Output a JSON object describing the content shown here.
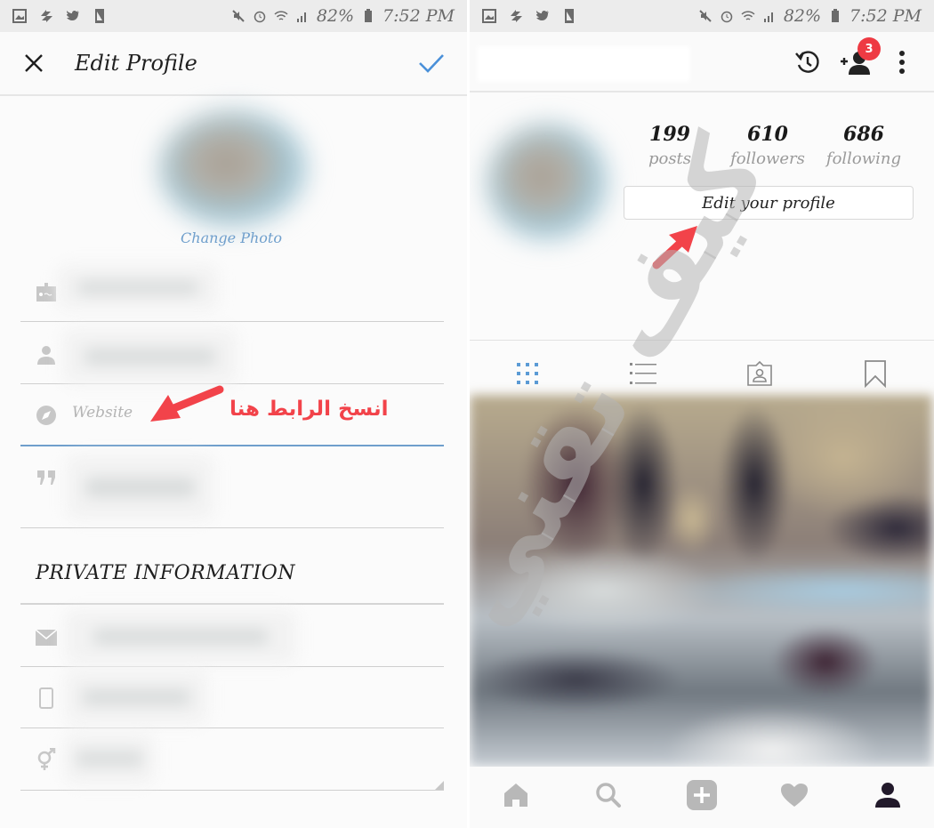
{
  "status_bar": {
    "battery": "82%",
    "time": "7:52 PM",
    "left_icons": [
      "gallery-icon",
      "pinwheel-icon",
      "twitter-icon",
      "tablet-icon"
    ],
    "right_icons": [
      "mute-icon",
      "alarm-icon",
      "wifi-icon",
      "signal-icon",
      "battery-icon"
    ]
  },
  "edit_profile": {
    "title": "Edit Profile",
    "close_icon": "close-icon",
    "save_icon": "check-icon",
    "change_photo": "Change Photo",
    "fields": [
      {
        "icon": "id-card-icon",
        "value": "",
        "blurred": true
      },
      {
        "icon": "person-icon",
        "value": "",
        "blurred": true
      },
      {
        "icon": "compass-icon",
        "value": "",
        "placeholder": "Website",
        "blurred": false
      },
      {
        "icon": "quote-icon",
        "value": "",
        "blurred": true
      }
    ],
    "private_section_title": "PRIVATE INFORMATION",
    "private_fields": [
      {
        "icon": "email-icon",
        "value": "",
        "blurred": true
      },
      {
        "icon": "phone-icon",
        "value": "",
        "blurred": true
      },
      {
        "icon": "gender-icon",
        "value": "",
        "blurred": true
      }
    ],
    "annotation": "انسخ الرابط هنا",
    "accent_color": "#4a90d9",
    "annotation_color": "#f2434a"
  },
  "watermark": "كيف تقني",
  "profile": {
    "header_icons": [
      "history-icon",
      "add-person-icon",
      "more-icon"
    ],
    "notification_count": "3",
    "stats": [
      {
        "value": "199",
        "label": "posts"
      },
      {
        "value": "610",
        "label": "followers"
      },
      {
        "value": "686",
        "label": "following"
      }
    ],
    "edit_button": "Edit your profile",
    "view_tabs": [
      "grid-icon",
      "list-icon",
      "tagged-icon",
      "bookmark-icon"
    ],
    "active_tab": "grid-icon",
    "bottom_nav": [
      "home-icon",
      "search-icon",
      "add-post-icon",
      "heart-icon",
      "profile-icon"
    ],
    "active_nav": "profile-icon"
  }
}
